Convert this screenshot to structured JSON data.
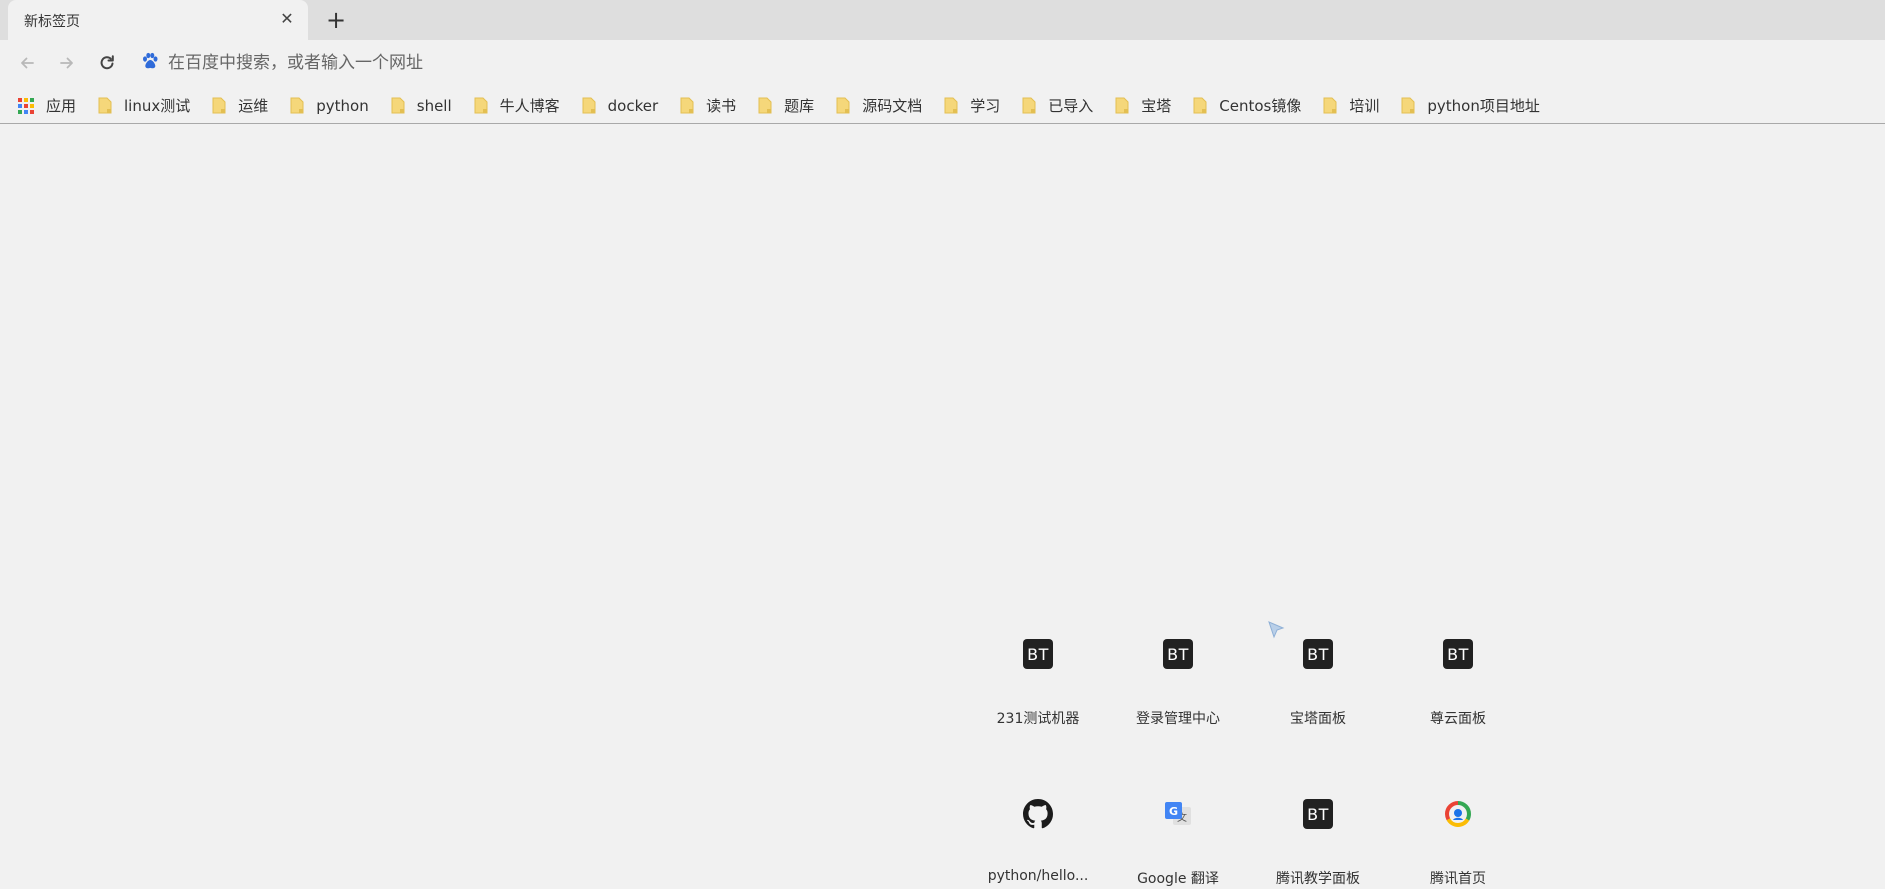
{
  "tab": {
    "title": "新标签页"
  },
  "omnibox": {
    "placeholder": "在百度中搜索，或者输入一个网址"
  },
  "bookmarks": [
    {
      "label": "应用",
      "icon": "apps-grid-icon"
    },
    {
      "label": "linux测试",
      "icon": "folder-icon"
    },
    {
      "label": "运维",
      "icon": "folder-icon"
    },
    {
      "label": "python",
      "icon": "folder-icon"
    },
    {
      "label": "shell",
      "icon": "folder-icon"
    },
    {
      "label": "牛人博客",
      "icon": "folder-icon"
    },
    {
      "label": "docker",
      "icon": "folder-icon"
    },
    {
      "label": "读书",
      "icon": "folder-icon"
    },
    {
      "label": "题库",
      "icon": "folder-icon"
    },
    {
      "label": "源码文档",
      "icon": "folder-icon"
    },
    {
      "label": "学习",
      "icon": "folder-icon"
    },
    {
      "label": "已导入",
      "icon": "folder-icon"
    },
    {
      "label": "宝塔",
      "icon": "folder-icon"
    },
    {
      "label": "Centos镜像",
      "icon": "folder-icon"
    },
    {
      "label": "培训",
      "icon": "folder-icon"
    },
    {
      "label": "python项目地址",
      "icon": "folder-icon"
    }
  ],
  "shortcuts": [
    {
      "label": "231测试机器",
      "icon": "bt-icon",
      "icon_text": "BT"
    },
    {
      "label": "登录管理中心",
      "icon": "bt-icon",
      "icon_text": "BT"
    },
    {
      "label": "宝塔面板",
      "icon": "bt-icon",
      "icon_text": "BT"
    },
    {
      "label": "尊云面板",
      "icon": "bt-icon",
      "icon_text": "BT"
    },
    {
      "label": "python/hello...",
      "icon": "github-icon"
    },
    {
      "label": "Google 翻译",
      "icon": "google-translate-icon"
    },
    {
      "label": "腾讯教学面板",
      "icon": "bt-icon",
      "icon_text": "BT"
    },
    {
      "label": "腾讯首页",
      "icon": "tencent-icon"
    }
  ],
  "colors": {
    "background": "#f1f1f1",
    "tabstrip": "#dedede",
    "folder": "#f5d77a",
    "bt_icon": "#212121",
    "baidu_blue": "#2f6bd9"
  }
}
